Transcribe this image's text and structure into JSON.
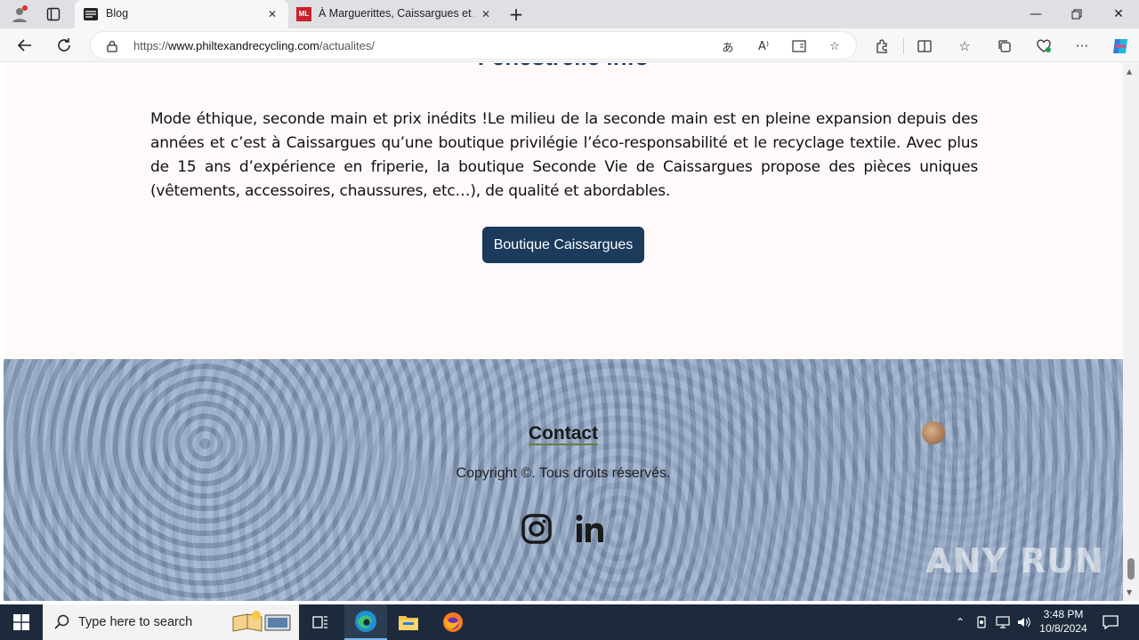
{
  "browser": {
    "tabs": [
      {
        "title": "Blog",
        "active": true
      },
      {
        "title": "À Marguerittes, Caissargues et Al",
        "active": false
      }
    ],
    "url": {
      "scheme": "https://",
      "host": "www.philtexandrecycling.com",
      "path": "/actualites/"
    }
  },
  "page": {
    "heading_partial": "Fenestrelle info",
    "article_text": "Mode éthique, seconde main et prix inédits !Le milieu de la seconde main est en pleine expansion depuis des années et c’est à Caissargues qu’une boutique privilégie l’éco-responsabilité et le recyclage textile. Avec plus de 15 ans d’expérience en friperie, la boutique Seconde Vie de Caissargues propose des pièces uniques (vêtements, accessoires, chaussures, etc…), de qualité et abordables.",
    "cta_label": "Boutique Caissargues",
    "footer": {
      "contact_label": "Contact",
      "copyright": "Copyright ©. Tous droits réservés.",
      "watermark": "ANY RUN"
    }
  },
  "taskbar": {
    "search_placeholder": "Type here to search",
    "time": "3:48 PM",
    "date": "10/8/2024"
  },
  "colors": {
    "brand_navy": "#1b3a5c",
    "page_bg": "#fff9fa",
    "taskbar_bg": "#1c2a3c"
  }
}
